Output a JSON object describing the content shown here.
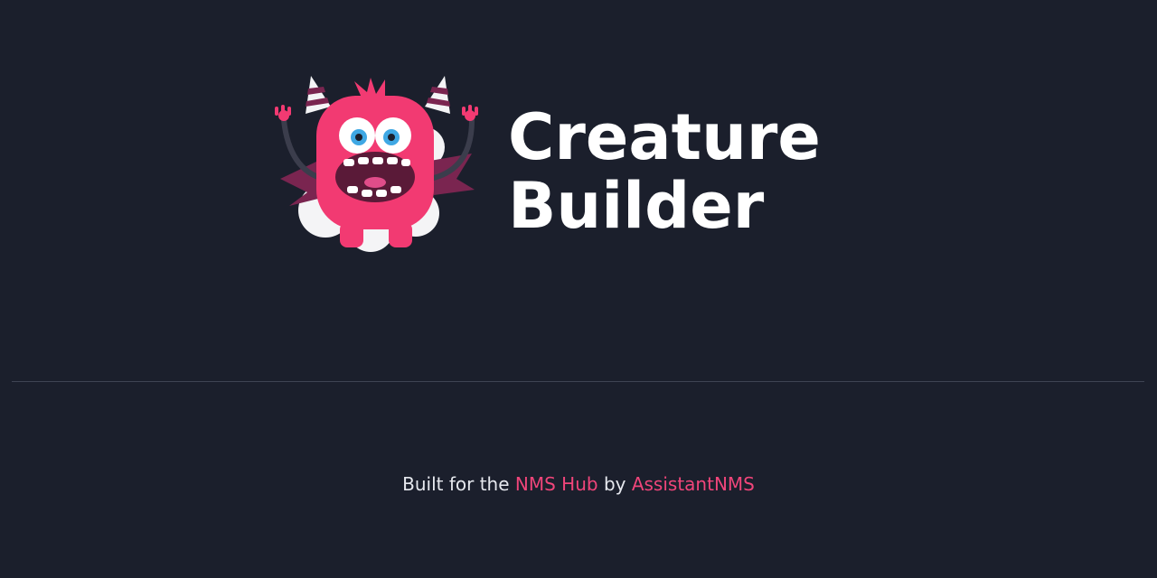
{
  "header": {
    "title_line1": "Creature",
    "title_line2": "Builder"
  },
  "footer": {
    "prefix": "Built for the",
    "hub_link": "NMS Hub",
    "by": "by",
    "author_link": "AssistantNMS"
  },
  "colors": {
    "background": "#1b1f2c",
    "accent": "#f0457a",
    "mascot_body": "#f23a72",
    "text": "#ffffff"
  },
  "icons": {
    "logo": "monster-mascot-icon"
  }
}
